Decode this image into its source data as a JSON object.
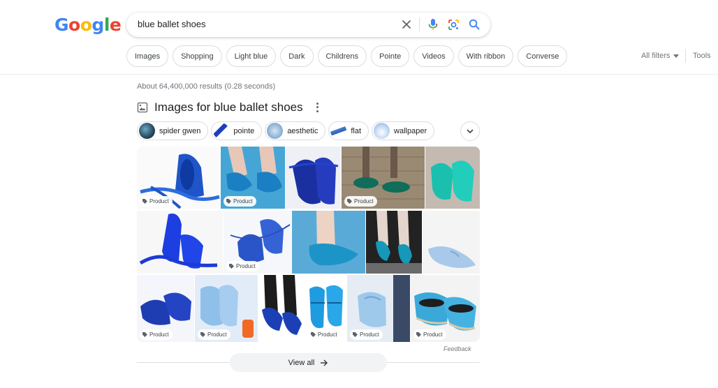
{
  "logo": {
    "letters": [
      "G",
      "o",
      "o",
      "g",
      "l",
      "e"
    ],
    "colors": [
      "#4285f4",
      "#ea4335",
      "#fbbc05",
      "#4285f4",
      "#34a853",
      "#ea4335"
    ]
  },
  "search": {
    "query": "blue ballet shoes",
    "icons": [
      "close-icon",
      "microphone-icon",
      "lens-icon",
      "search-icon"
    ]
  },
  "filters": {
    "chips": [
      "Images",
      "Shopping",
      "Light blue",
      "Dark",
      "Childrens",
      "Pointe",
      "Videos",
      "With ribbon",
      "Converse"
    ],
    "all_filters": "All filters",
    "tools": "Tools"
  },
  "result_stats": "About 64,400,000 results (0.28 seconds)",
  "images_section": {
    "title": "Images for blue ballet shoes",
    "related": [
      "spider gwen",
      "pointe",
      "aesthetic",
      "flat",
      "wallpaper"
    ],
    "product_label": "Product",
    "feedback": "Feedback",
    "view_all": "View all"
  },
  "colors": {
    "accent": "#1a73e8",
    "chip_border": "#dadce0",
    "muted_text": "#70757a"
  }
}
